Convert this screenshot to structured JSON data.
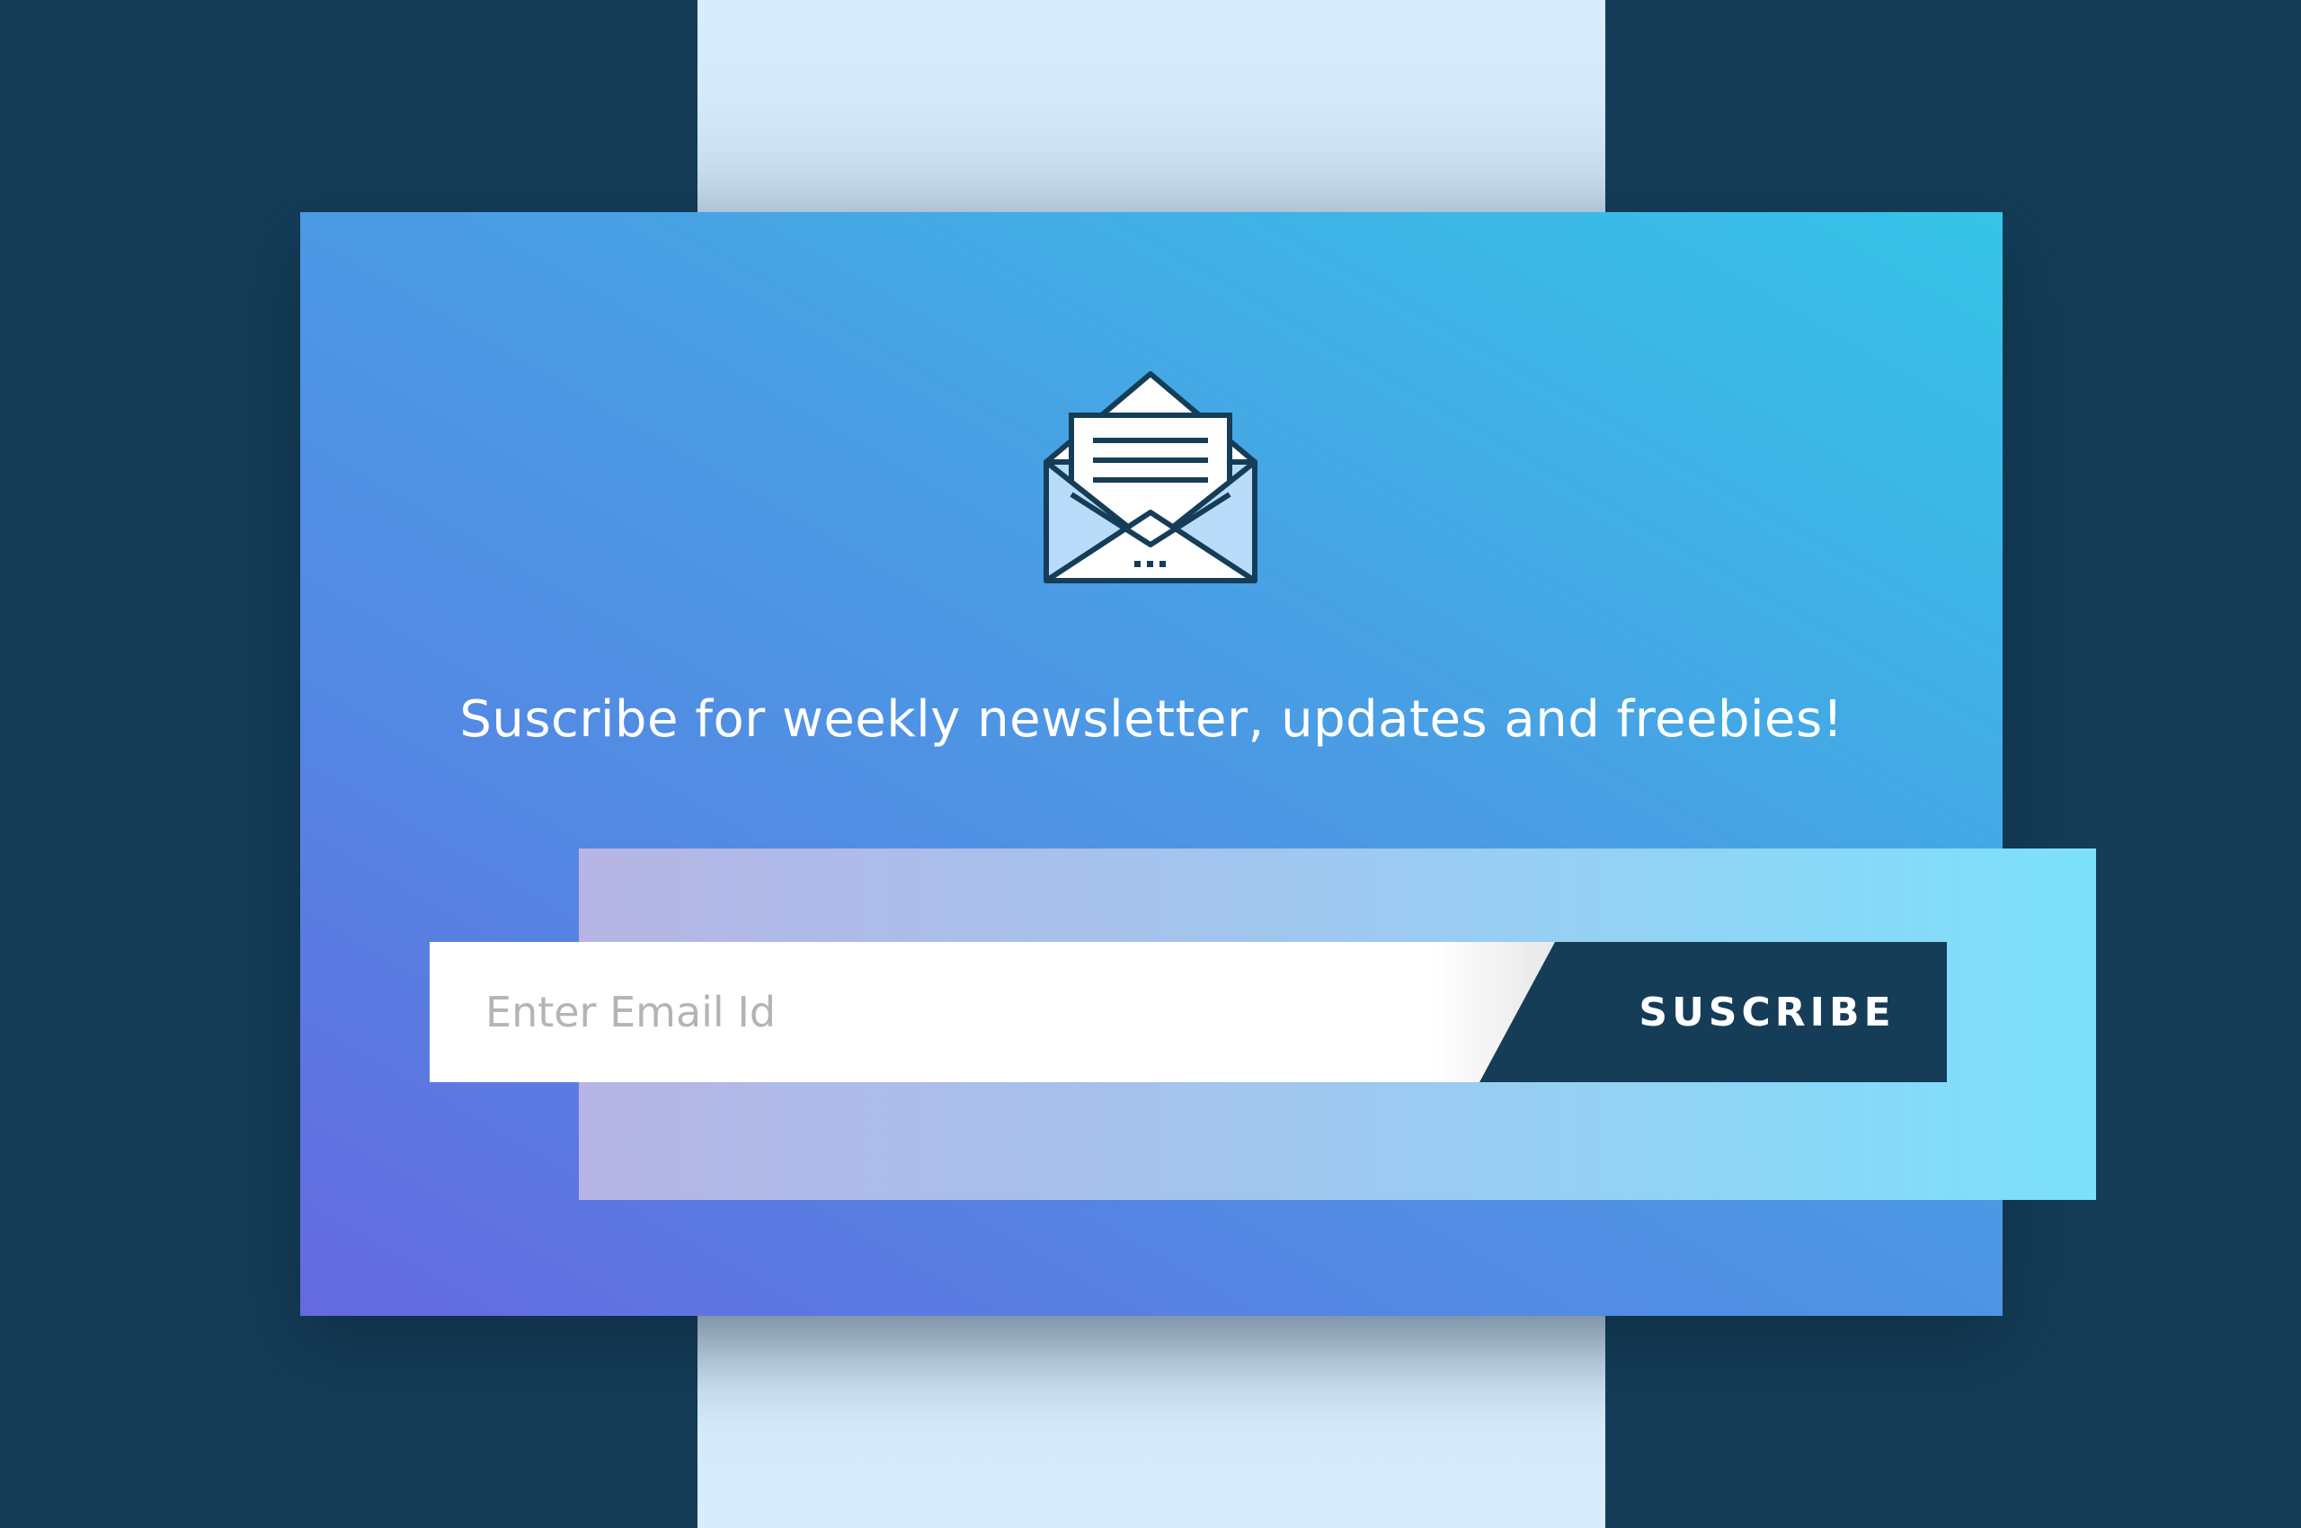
{
  "newsletter": {
    "icon": "open-envelope-icon",
    "headline": "Suscribe for weekly newsletter, updates and freebies!",
    "email_placeholder": "Enter Email Id",
    "email_value": "",
    "subscribe_label": "SUSCRIBE"
  },
  "colors": {
    "page_background": "#153d58",
    "strip": "#d6eafb",
    "card_gradient_start": "#6569e0",
    "card_gradient_end": "#36c4e8",
    "button": "#153d58",
    "icon_stroke": "#153d58",
    "icon_fill_light": "#b8dcfa"
  }
}
